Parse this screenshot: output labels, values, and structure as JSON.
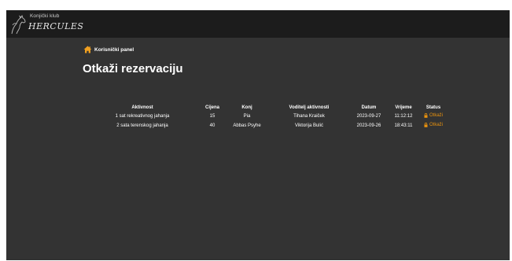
{
  "header": {
    "brand_subtitle": "Konjički klub",
    "brand_name": "HERCULES"
  },
  "breadcrumb": {
    "icon": "home-icon",
    "label": "Korisnički panel"
  },
  "page": {
    "title": "Otkaži rezervaciju"
  },
  "table": {
    "headers": [
      "Aktivnost",
      "Cijena",
      "Konj",
      "Voditelj aktivnosti",
      "Datum",
      "Vrijeme",
      "Status"
    ],
    "rows": [
      {
        "aktivnost": "1 sat rekreativnog jahanja",
        "cijena": "15",
        "konj": "Pia",
        "voditelj": "Tihana Kraiček",
        "datum": "2023-09-27",
        "vrijeme": "11:12:12",
        "status": "Otkaži"
      },
      {
        "aktivnost": "2 sata terenskog jahanja",
        "cijena": "40",
        "konj": "Abbas Psyhe",
        "voditelj": "Viktorija Bulić",
        "datum": "2023-09-26",
        "vrijeme": "18:43:11",
        "status": "Otkaži"
      }
    ]
  },
  "colors": {
    "background": "#333333",
    "topbar": "#1c1c1c",
    "accent": "#e8920e",
    "home_icon": "#f0a020"
  }
}
